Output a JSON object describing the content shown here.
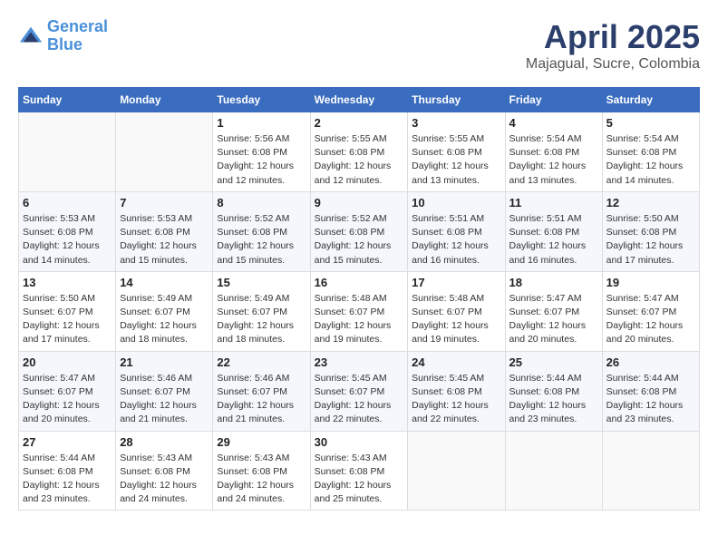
{
  "header": {
    "logo_line1": "General",
    "logo_line2": "Blue",
    "title": "April 2025",
    "subtitle": "Majagual, Sucre, Colombia"
  },
  "weekdays": [
    "Sunday",
    "Monday",
    "Tuesday",
    "Wednesday",
    "Thursday",
    "Friday",
    "Saturday"
  ],
  "weeks": [
    [
      {
        "day": "",
        "info": ""
      },
      {
        "day": "",
        "info": ""
      },
      {
        "day": "1",
        "info": "Sunrise: 5:56 AM\nSunset: 6:08 PM\nDaylight: 12 hours\nand 12 minutes."
      },
      {
        "day": "2",
        "info": "Sunrise: 5:55 AM\nSunset: 6:08 PM\nDaylight: 12 hours\nand 12 minutes."
      },
      {
        "day": "3",
        "info": "Sunrise: 5:55 AM\nSunset: 6:08 PM\nDaylight: 12 hours\nand 13 minutes."
      },
      {
        "day": "4",
        "info": "Sunrise: 5:54 AM\nSunset: 6:08 PM\nDaylight: 12 hours\nand 13 minutes."
      },
      {
        "day": "5",
        "info": "Sunrise: 5:54 AM\nSunset: 6:08 PM\nDaylight: 12 hours\nand 14 minutes."
      }
    ],
    [
      {
        "day": "6",
        "info": "Sunrise: 5:53 AM\nSunset: 6:08 PM\nDaylight: 12 hours\nand 14 minutes."
      },
      {
        "day": "7",
        "info": "Sunrise: 5:53 AM\nSunset: 6:08 PM\nDaylight: 12 hours\nand 15 minutes."
      },
      {
        "day": "8",
        "info": "Sunrise: 5:52 AM\nSunset: 6:08 PM\nDaylight: 12 hours\nand 15 minutes."
      },
      {
        "day": "9",
        "info": "Sunrise: 5:52 AM\nSunset: 6:08 PM\nDaylight: 12 hours\nand 15 minutes."
      },
      {
        "day": "10",
        "info": "Sunrise: 5:51 AM\nSunset: 6:08 PM\nDaylight: 12 hours\nand 16 minutes."
      },
      {
        "day": "11",
        "info": "Sunrise: 5:51 AM\nSunset: 6:08 PM\nDaylight: 12 hours\nand 16 minutes."
      },
      {
        "day": "12",
        "info": "Sunrise: 5:50 AM\nSunset: 6:08 PM\nDaylight: 12 hours\nand 17 minutes."
      }
    ],
    [
      {
        "day": "13",
        "info": "Sunrise: 5:50 AM\nSunset: 6:07 PM\nDaylight: 12 hours\nand 17 minutes."
      },
      {
        "day": "14",
        "info": "Sunrise: 5:49 AM\nSunset: 6:07 PM\nDaylight: 12 hours\nand 18 minutes."
      },
      {
        "day": "15",
        "info": "Sunrise: 5:49 AM\nSunset: 6:07 PM\nDaylight: 12 hours\nand 18 minutes."
      },
      {
        "day": "16",
        "info": "Sunrise: 5:48 AM\nSunset: 6:07 PM\nDaylight: 12 hours\nand 19 minutes."
      },
      {
        "day": "17",
        "info": "Sunrise: 5:48 AM\nSunset: 6:07 PM\nDaylight: 12 hours\nand 19 minutes."
      },
      {
        "day": "18",
        "info": "Sunrise: 5:47 AM\nSunset: 6:07 PM\nDaylight: 12 hours\nand 20 minutes."
      },
      {
        "day": "19",
        "info": "Sunrise: 5:47 AM\nSunset: 6:07 PM\nDaylight: 12 hours\nand 20 minutes."
      }
    ],
    [
      {
        "day": "20",
        "info": "Sunrise: 5:47 AM\nSunset: 6:07 PM\nDaylight: 12 hours\nand 20 minutes."
      },
      {
        "day": "21",
        "info": "Sunrise: 5:46 AM\nSunset: 6:07 PM\nDaylight: 12 hours\nand 21 minutes."
      },
      {
        "day": "22",
        "info": "Sunrise: 5:46 AM\nSunset: 6:07 PM\nDaylight: 12 hours\nand 21 minutes."
      },
      {
        "day": "23",
        "info": "Sunrise: 5:45 AM\nSunset: 6:07 PM\nDaylight: 12 hours\nand 22 minutes."
      },
      {
        "day": "24",
        "info": "Sunrise: 5:45 AM\nSunset: 6:08 PM\nDaylight: 12 hours\nand 22 minutes."
      },
      {
        "day": "25",
        "info": "Sunrise: 5:44 AM\nSunset: 6:08 PM\nDaylight: 12 hours\nand 23 minutes."
      },
      {
        "day": "26",
        "info": "Sunrise: 5:44 AM\nSunset: 6:08 PM\nDaylight: 12 hours\nand 23 minutes."
      }
    ],
    [
      {
        "day": "27",
        "info": "Sunrise: 5:44 AM\nSunset: 6:08 PM\nDaylight: 12 hours\nand 23 minutes."
      },
      {
        "day": "28",
        "info": "Sunrise: 5:43 AM\nSunset: 6:08 PM\nDaylight: 12 hours\nand 24 minutes."
      },
      {
        "day": "29",
        "info": "Sunrise: 5:43 AM\nSunset: 6:08 PM\nDaylight: 12 hours\nand 24 minutes."
      },
      {
        "day": "30",
        "info": "Sunrise: 5:43 AM\nSunset: 6:08 PM\nDaylight: 12 hours\nand 25 minutes."
      },
      {
        "day": "",
        "info": ""
      },
      {
        "day": "",
        "info": ""
      },
      {
        "day": "",
        "info": ""
      }
    ]
  ]
}
